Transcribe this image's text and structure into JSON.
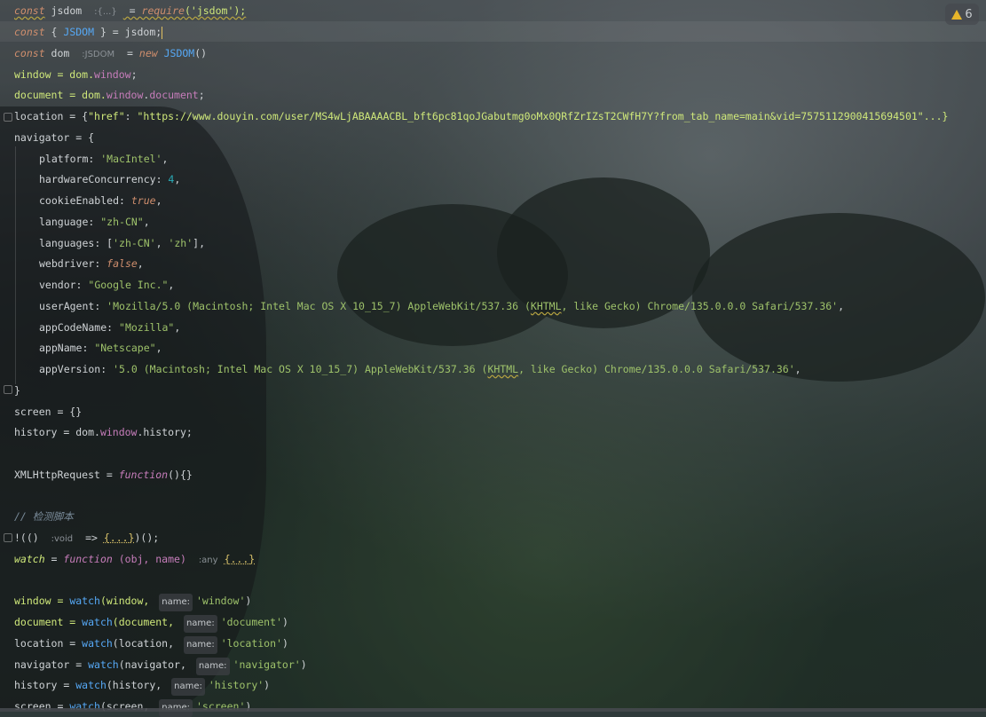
{
  "warnings": {
    "count": "6",
    "icon": "warning-icon"
  },
  "code": {
    "l1": {
      "kw": "const",
      "name": " jsdom ",
      "hint": ":{...}",
      "rest": " = ",
      "req": "require",
      "arg": "('jsdom');"
    },
    "l2": {
      "kw": "const",
      "a": " { ",
      "cls": "JSDOM",
      "b": " } = jsdom;"
    },
    "l3": {
      "kw": "const",
      "name": " dom ",
      "hint": ":JSDOM",
      "eq": " = ",
      "new": "new",
      "cls": " JSDOM",
      "tail": "()"
    },
    "l4": {
      "a": "window = dom.",
      "b": "window",
      "c": ";"
    },
    "l5": {
      "a": "document = dom.",
      "b": "window",
      "c": ".",
      "d": "document",
      "e": ";"
    },
    "l6": {
      "a": "location = {",
      "key": "\"href\"",
      "b": ": ",
      "url": "\"https://www.douyin.com/user/MS4wLjABAAAACBL_bft6pc81qoJGabutmg0oMx0QRfZrIZsT2CWfH7Y?from_tab_name=main&vid=7575112900415694501\"",
      "c": "...}"
    },
    "l7": {
      "a": "navigator = {"
    },
    "l8": {
      "k": "platform",
      "v": "'MacIntel'",
      "c": ","
    },
    "l9": {
      "k": "hardwareConcurrency",
      "v": "4",
      "c": ","
    },
    "l10": {
      "k": "cookieEnabled",
      "v": "true",
      "c": ","
    },
    "l11": {
      "k": "language",
      "v": "\"zh-CN\"",
      "c": ","
    },
    "l12": {
      "k": "languages",
      "a": "[",
      "v1": "'zh-CN'",
      "s": ", ",
      "v2": "'zh'",
      "b": "],"
    },
    "l13": {
      "k": "webdriver",
      "v": "false",
      "c": ","
    },
    "l14": {
      "k": "vendor",
      "v": "\"Google Inc.\"",
      "c": ","
    },
    "l15": {
      "k": "userAgent",
      "v1": "'Mozilla/5.0 (Macintosh; Intel Mac OS X 10_15_7) AppleWebKit/537.36 (",
      "u": "KHTML",
      "v2": ", like Gecko) Chrome/135.0.0.0 Safari/537.36'",
      "c": ","
    },
    "l16": {
      "k": "appCodeName",
      "v": "\"Mozilla\"",
      "c": ","
    },
    "l17": {
      "k": "appName",
      "v": "\"Netscape\"",
      "c": ","
    },
    "l18": {
      "k": "appVersion",
      "v1": "'5.0 (Macintosh; Intel Mac OS X 10_15_7) AppleWebKit/537.36 (",
      "u": "KHTML",
      "v2": ", like Gecko) Chrome/135.0.0.0 Safari/537.36'",
      "c": ","
    },
    "l19": {
      "a": "}"
    },
    "l20": {
      "a": "screen = {}"
    },
    "l21": {
      "a": "history = dom.",
      "b": "window",
      "c": ".history;"
    },
    "l22": {
      "a": "XMLHttpRequest = ",
      "fn": "function",
      "b": "(){}"
    },
    "l23": {
      "cmt": "// 检测脚本"
    },
    "l24": {
      "a": "!(() ",
      "hint": ":void",
      "b": " => ",
      "fold": "{...}",
      "c": ")();"
    },
    "l25": {
      "name": "watch",
      "eq": " = ",
      "fn": "function",
      "params": " (obj, name) ",
      "hint": ":any",
      "fold": "{...}"
    },
    "l26": {
      "a": "window = ",
      "fn": "watch",
      "b": "(window, ",
      "hint": "name:",
      "s": "'window'",
      "c": ")"
    },
    "l27": {
      "a": "document = ",
      "fn": "watch",
      "b": "(document, ",
      "hint": "name:",
      "s": "'document'",
      "c": ")"
    },
    "l28": {
      "a": "location = ",
      "fn": "watch",
      "b": "(location, ",
      "hint": "name:",
      "s": "'location'",
      "c": ")"
    },
    "l29": {
      "a": "navigator = ",
      "fn": "watch",
      "b": "(navigator, ",
      "hint": "name:",
      "s": "'navigator'",
      "c": ")"
    },
    "l30": {
      "a": "history = ",
      "fn": "watch",
      "b": "(history, ",
      "hint": "name:",
      "s": "'history'",
      "c": ")"
    },
    "l31": {
      "a": "screen = ",
      "fn": "watch",
      "b": "(screen, ",
      "hint": "name:",
      "s": "'screen'",
      "c": ")"
    }
  }
}
